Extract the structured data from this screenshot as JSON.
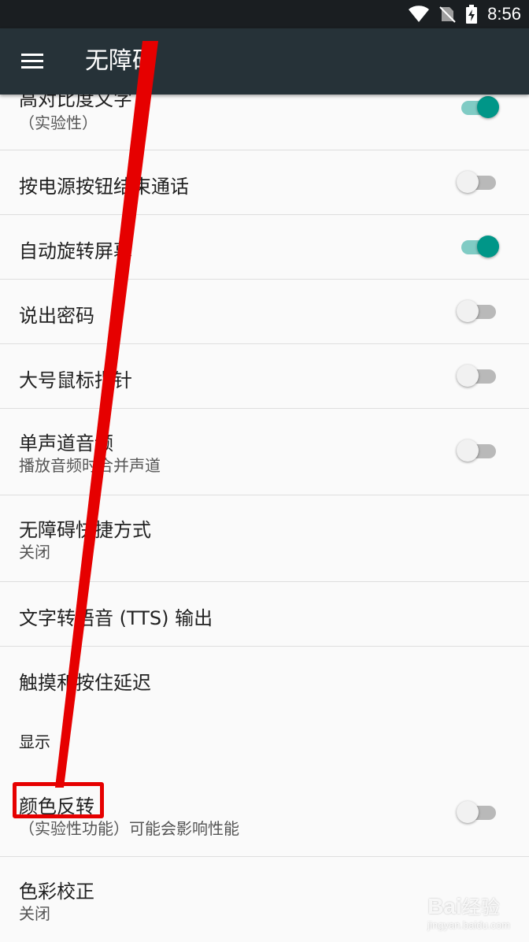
{
  "status_bar": {
    "time": "8:56"
  },
  "app_bar": {
    "title": "无障碍"
  },
  "settings": [
    {
      "title": "高对比度文字",
      "subtitle": "（实验性）",
      "toggle": true
    },
    {
      "title": "按电源按钮结束通话",
      "toggle": false
    },
    {
      "title": "自动旋转屏幕",
      "toggle": true
    },
    {
      "title": "说出密码",
      "toggle": false
    },
    {
      "title": "大号鼠标指针",
      "toggle": false
    },
    {
      "title": "单声道音频",
      "subtitle": "播放音频时合并声道",
      "toggle": false
    },
    {
      "title": "无障碍快捷方式",
      "subtitle": "关闭"
    },
    {
      "title": "文字转语音 (TTS) 输出"
    },
    {
      "title": "触摸和按住延迟"
    }
  ],
  "display_category": "显示",
  "display_settings": [
    {
      "title": "颜色反转",
      "subtitle": "（实验性功能）可能会影响性能",
      "toggle": false
    },
    {
      "title": "色彩校正",
      "subtitle": "关闭"
    }
  ],
  "watermark": {
    "brand": "Bai",
    "brand_cn": "经验",
    "url": "jingyan.baidu.com"
  },
  "colors": {
    "accent": "#009688",
    "app_bar": "#263238",
    "annotation": "#e60000"
  }
}
